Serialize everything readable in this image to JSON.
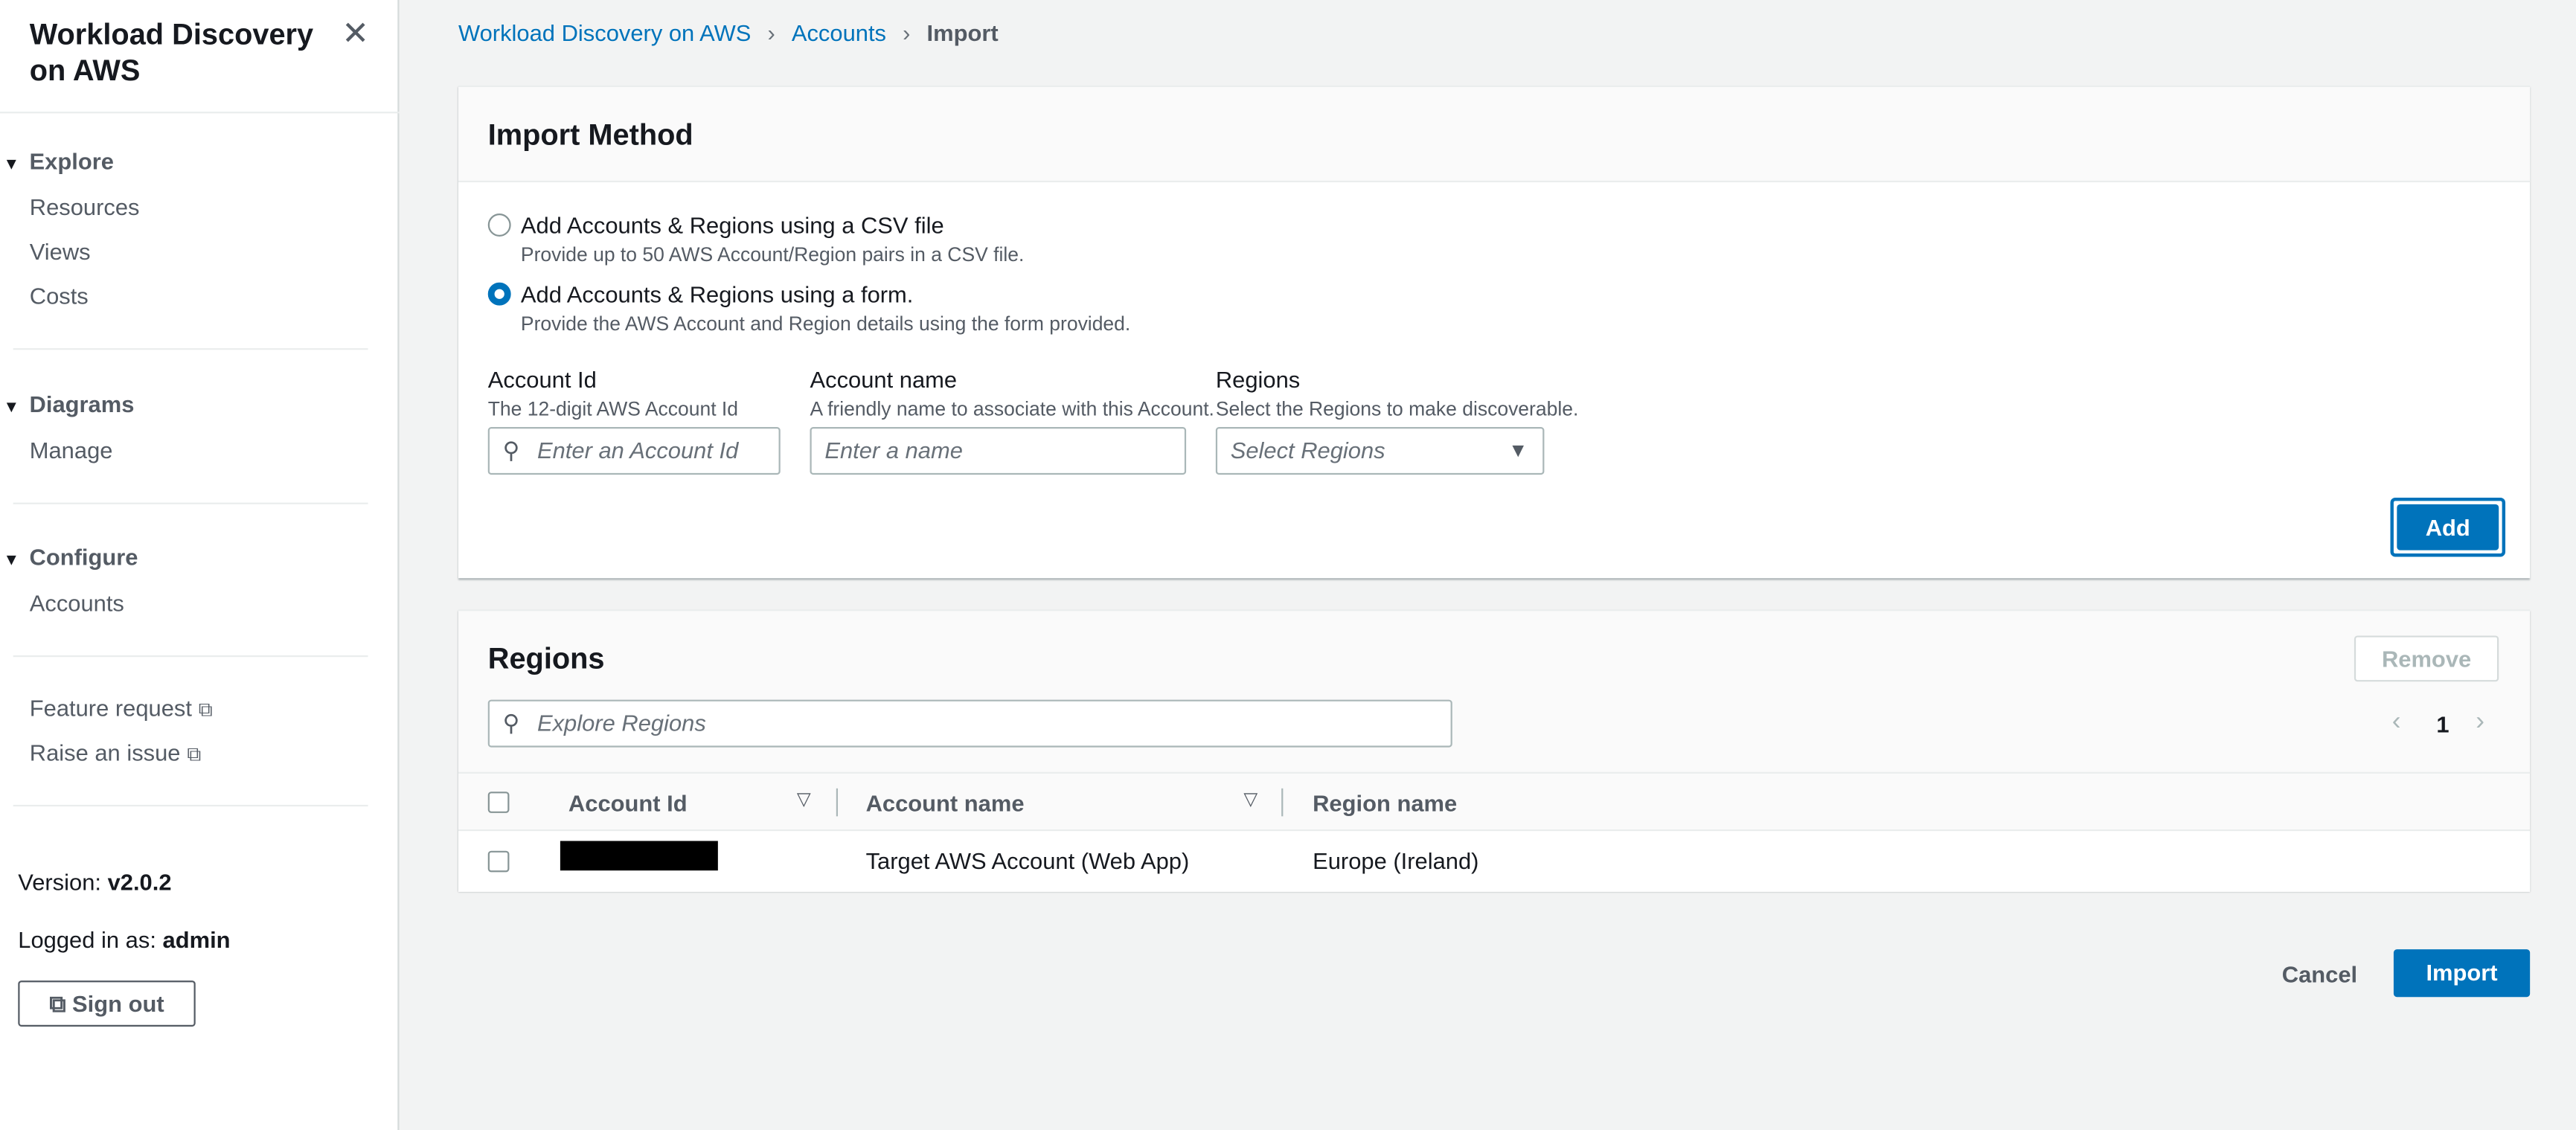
{
  "sidebar": {
    "title": "Workload Discovery on AWS",
    "sections": [
      {
        "label": "Explore",
        "items": [
          "Resources",
          "Views",
          "Costs"
        ]
      },
      {
        "label": "Diagrams",
        "items": [
          "Manage"
        ]
      },
      {
        "label": "Configure",
        "items": [
          "Accounts"
        ]
      }
    ],
    "links": [
      "Feature request",
      "Raise an issue"
    ],
    "version_label": "Version:",
    "version": "v2.0.2",
    "logged_label": "Logged in as:",
    "user": "admin",
    "sign_out": "Sign out"
  },
  "breadcrumb": [
    "Workload Discovery on AWS",
    "Accounts",
    "Import"
  ],
  "import_method": {
    "title": "Import Method",
    "options": [
      {
        "label": "Add Accounts & Regions using a CSV file",
        "desc": "Provide up to 50 AWS Account/Region pairs in a CSV file.",
        "selected": false
      },
      {
        "label": "Add Accounts & Regions using a form.",
        "desc": "Provide the AWS Account and Region details using the form provided.",
        "selected": true
      }
    ],
    "fields": [
      {
        "label": "Account Id",
        "desc": "The 12-digit AWS Account Id",
        "placeholder": "Enter an Account Id"
      },
      {
        "label": "Account name",
        "desc": "A friendly name to associate with this Account.",
        "placeholder": "Enter a name"
      },
      {
        "label": "Regions",
        "desc": "Select the Regions to make discoverable.",
        "placeholder": "Select Regions"
      }
    ],
    "add": "Add"
  },
  "regions": {
    "title": "Regions",
    "remove": "Remove",
    "search_placeholder": "Explore Regions",
    "page": "1",
    "columns": [
      "Account Id",
      "Account name",
      "Region name"
    ],
    "rows": [
      {
        "account_name": "Target AWS Account (Web App)",
        "region": "Europe (Ireland)"
      }
    ]
  },
  "footer": {
    "cancel": "Cancel",
    "import": "Import"
  },
  "colors": {
    "accent": "#0073bb",
    "background": "#f2f3f3"
  }
}
